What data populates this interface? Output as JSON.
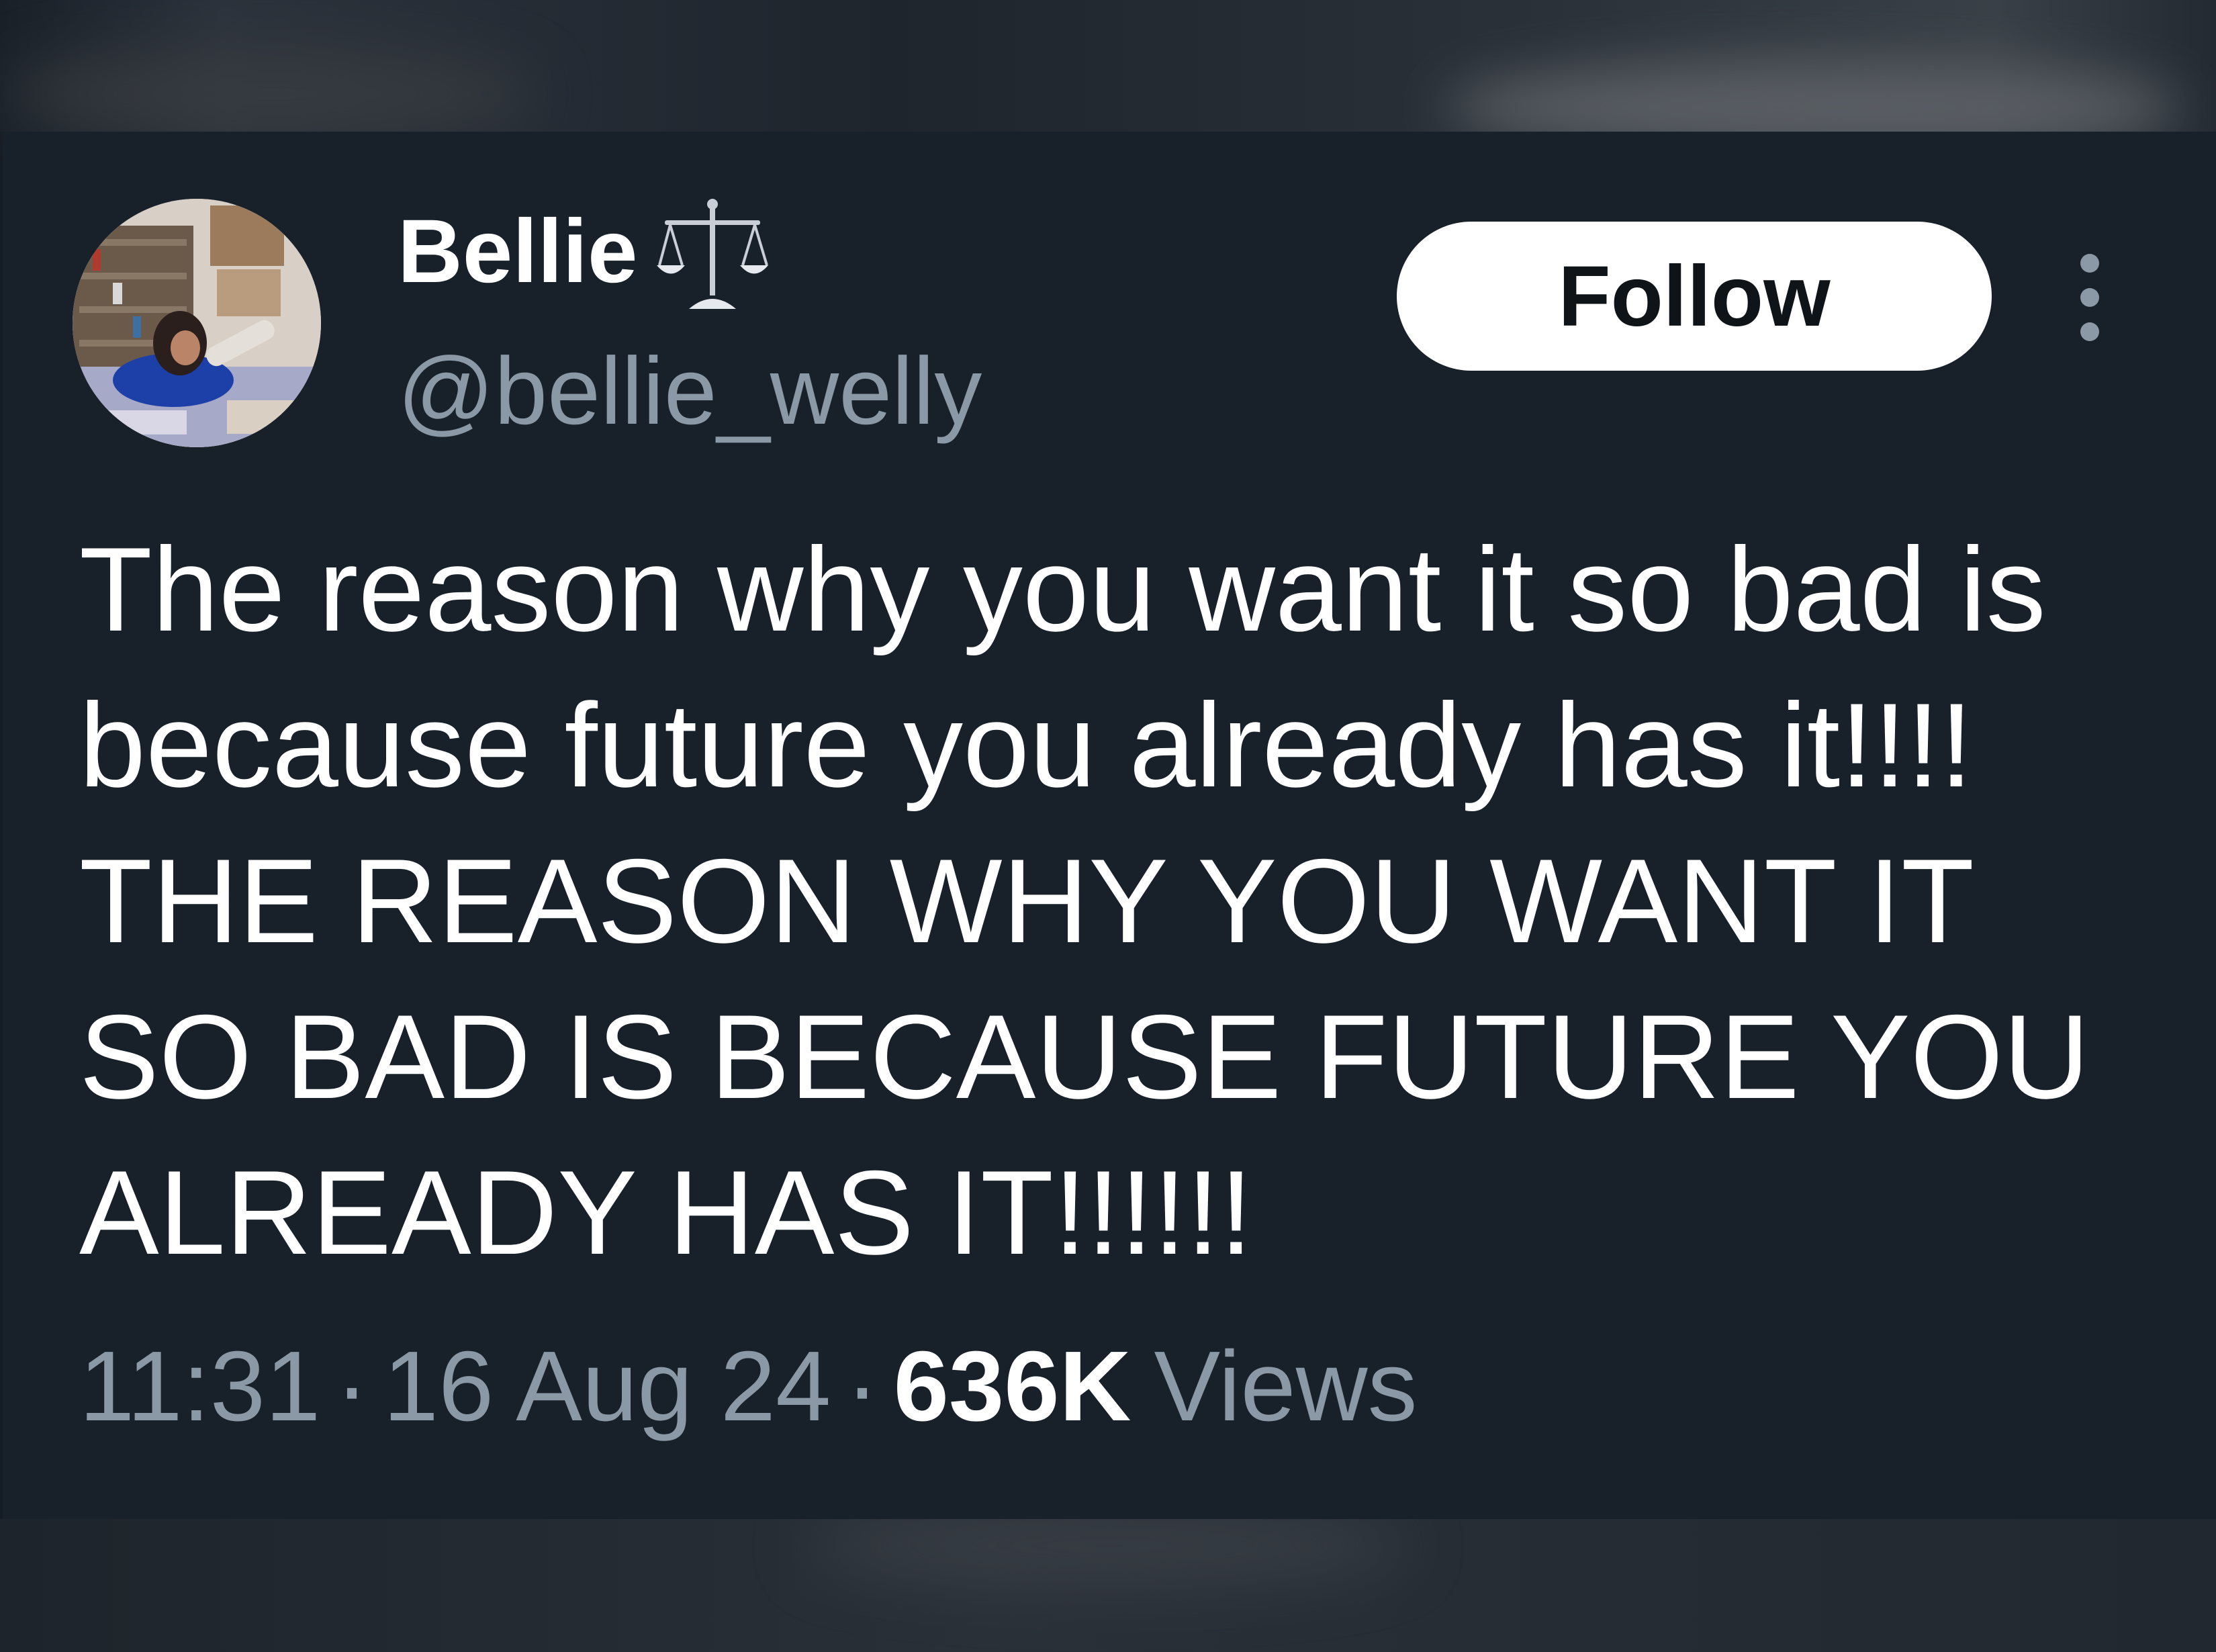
{
  "author": {
    "display_name": "Bellie",
    "display_name_icon": "balance-scale-icon",
    "handle": "@bellie_welly",
    "avatar": "profile-photo"
  },
  "actions": {
    "follow_label": "Follow",
    "more_icon": "more-options-icon"
  },
  "tweet": {
    "lines": [
      "The reason why you want it so bad is",
      "because future you already has it!!!!",
      "THE REASON WHY YOU WANT IT",
      "SO BAD IS BECAUSE FUTURE YOU",
      "ALREADY HAS IT!!!!!!"
    ]
  },
  "meta": {
    "time": "11:31",
    "separator": "·",
    "date": "16 Aug 24",
    "views_count": "636K",
    "views_label": "Views"
  },
  "colors": {
    "card_background": "#18202a",
    "primary_text": "#ffffff",
    "secondary_text": "#8b98a5",
    "button_background": "#ffffff",
    "button_text": "#0f1419"
  }
}
